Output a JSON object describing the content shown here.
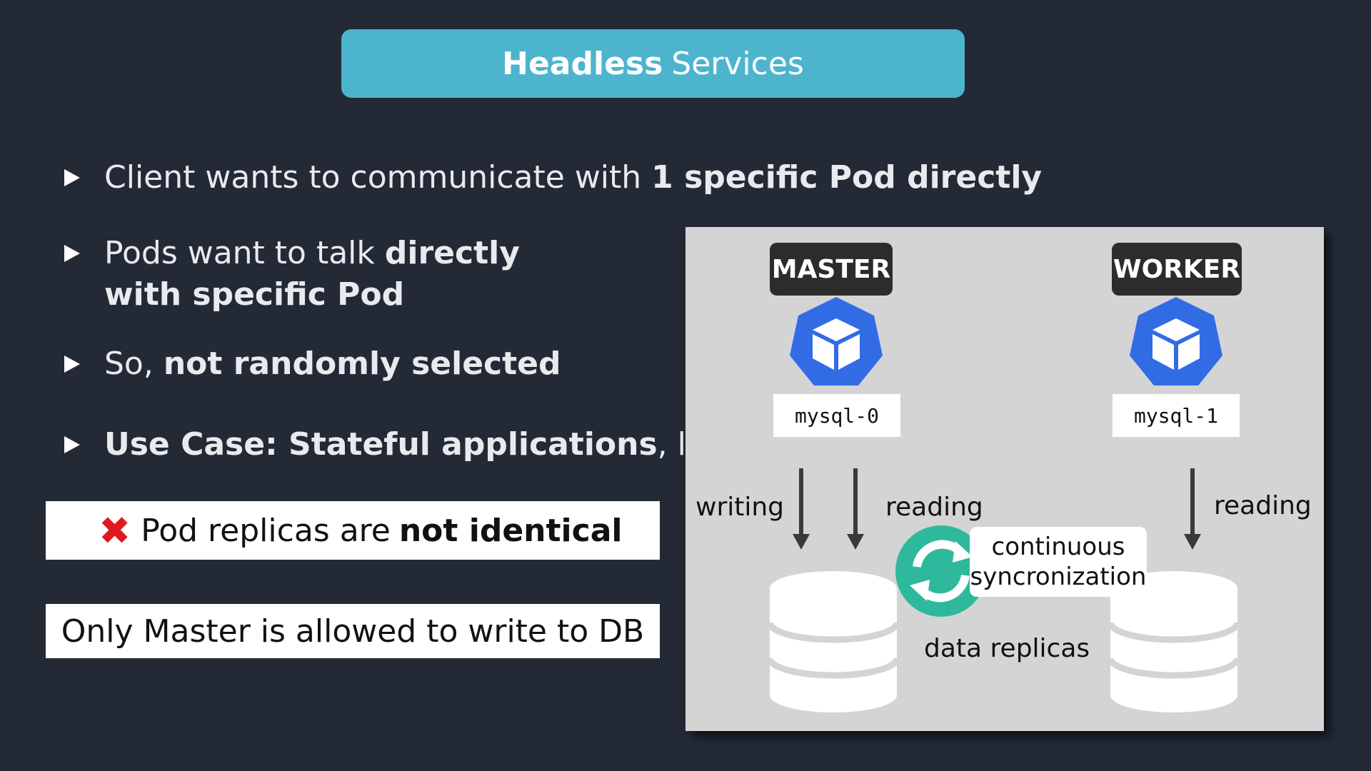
{
  "title": {
    "bold": "Headless",
    "rest": "Services"
  },
  "bullets": [
    {
      "pre": "Client wants to communicate with ",
      "bold": "1 specific Pod directly",
      "post": ""
    },
    {
      "pre": "Pods want to talk ",
      "bold": "directly",
      "line2": "with specific Pod"
    },
    {
      "pre": "So, ",
      "bold": "not randomly selected",
      "post": ""
    },
    {
      "pre": "",
      "bold": "Use Case: Stateful applications",
      "post": ", like"
    }
  ],
  "callouts": {
    "not_identical": {
      "mark": "❌",
      "pre": "Pod replicas are ",
      "bold": "not identical"
    },
    "master_only": "Only Master is allowed to write to DB"
  },
  "diagram": {
    "master": {
      "role": "MASTER",
      "pod": "mysql-0"
    },
    "worker": {
      "role": "WORKER",
      "pod": "mysql-1"
    },
    "labels": {
      "writing": "writing",
      "reading_master": "reading",
      "reading_worker": "reading",
      "sync_line1": "continuous",
      "sync_line2": "syncronization",
      "replicas": "data replicas"
    },
    "icons": [
      "kubernetes-pod-icon",
      "database-icon",
      "sync-icon",
      "arrow-down-icon"
    ],
    "colors": {
      "pod_blue": "#326ce5",
      "sync_green": "#2fb99c",
      "title_bar": "#4db4cd",
      "cross_red": "#e0191e"
    }
  }
}
